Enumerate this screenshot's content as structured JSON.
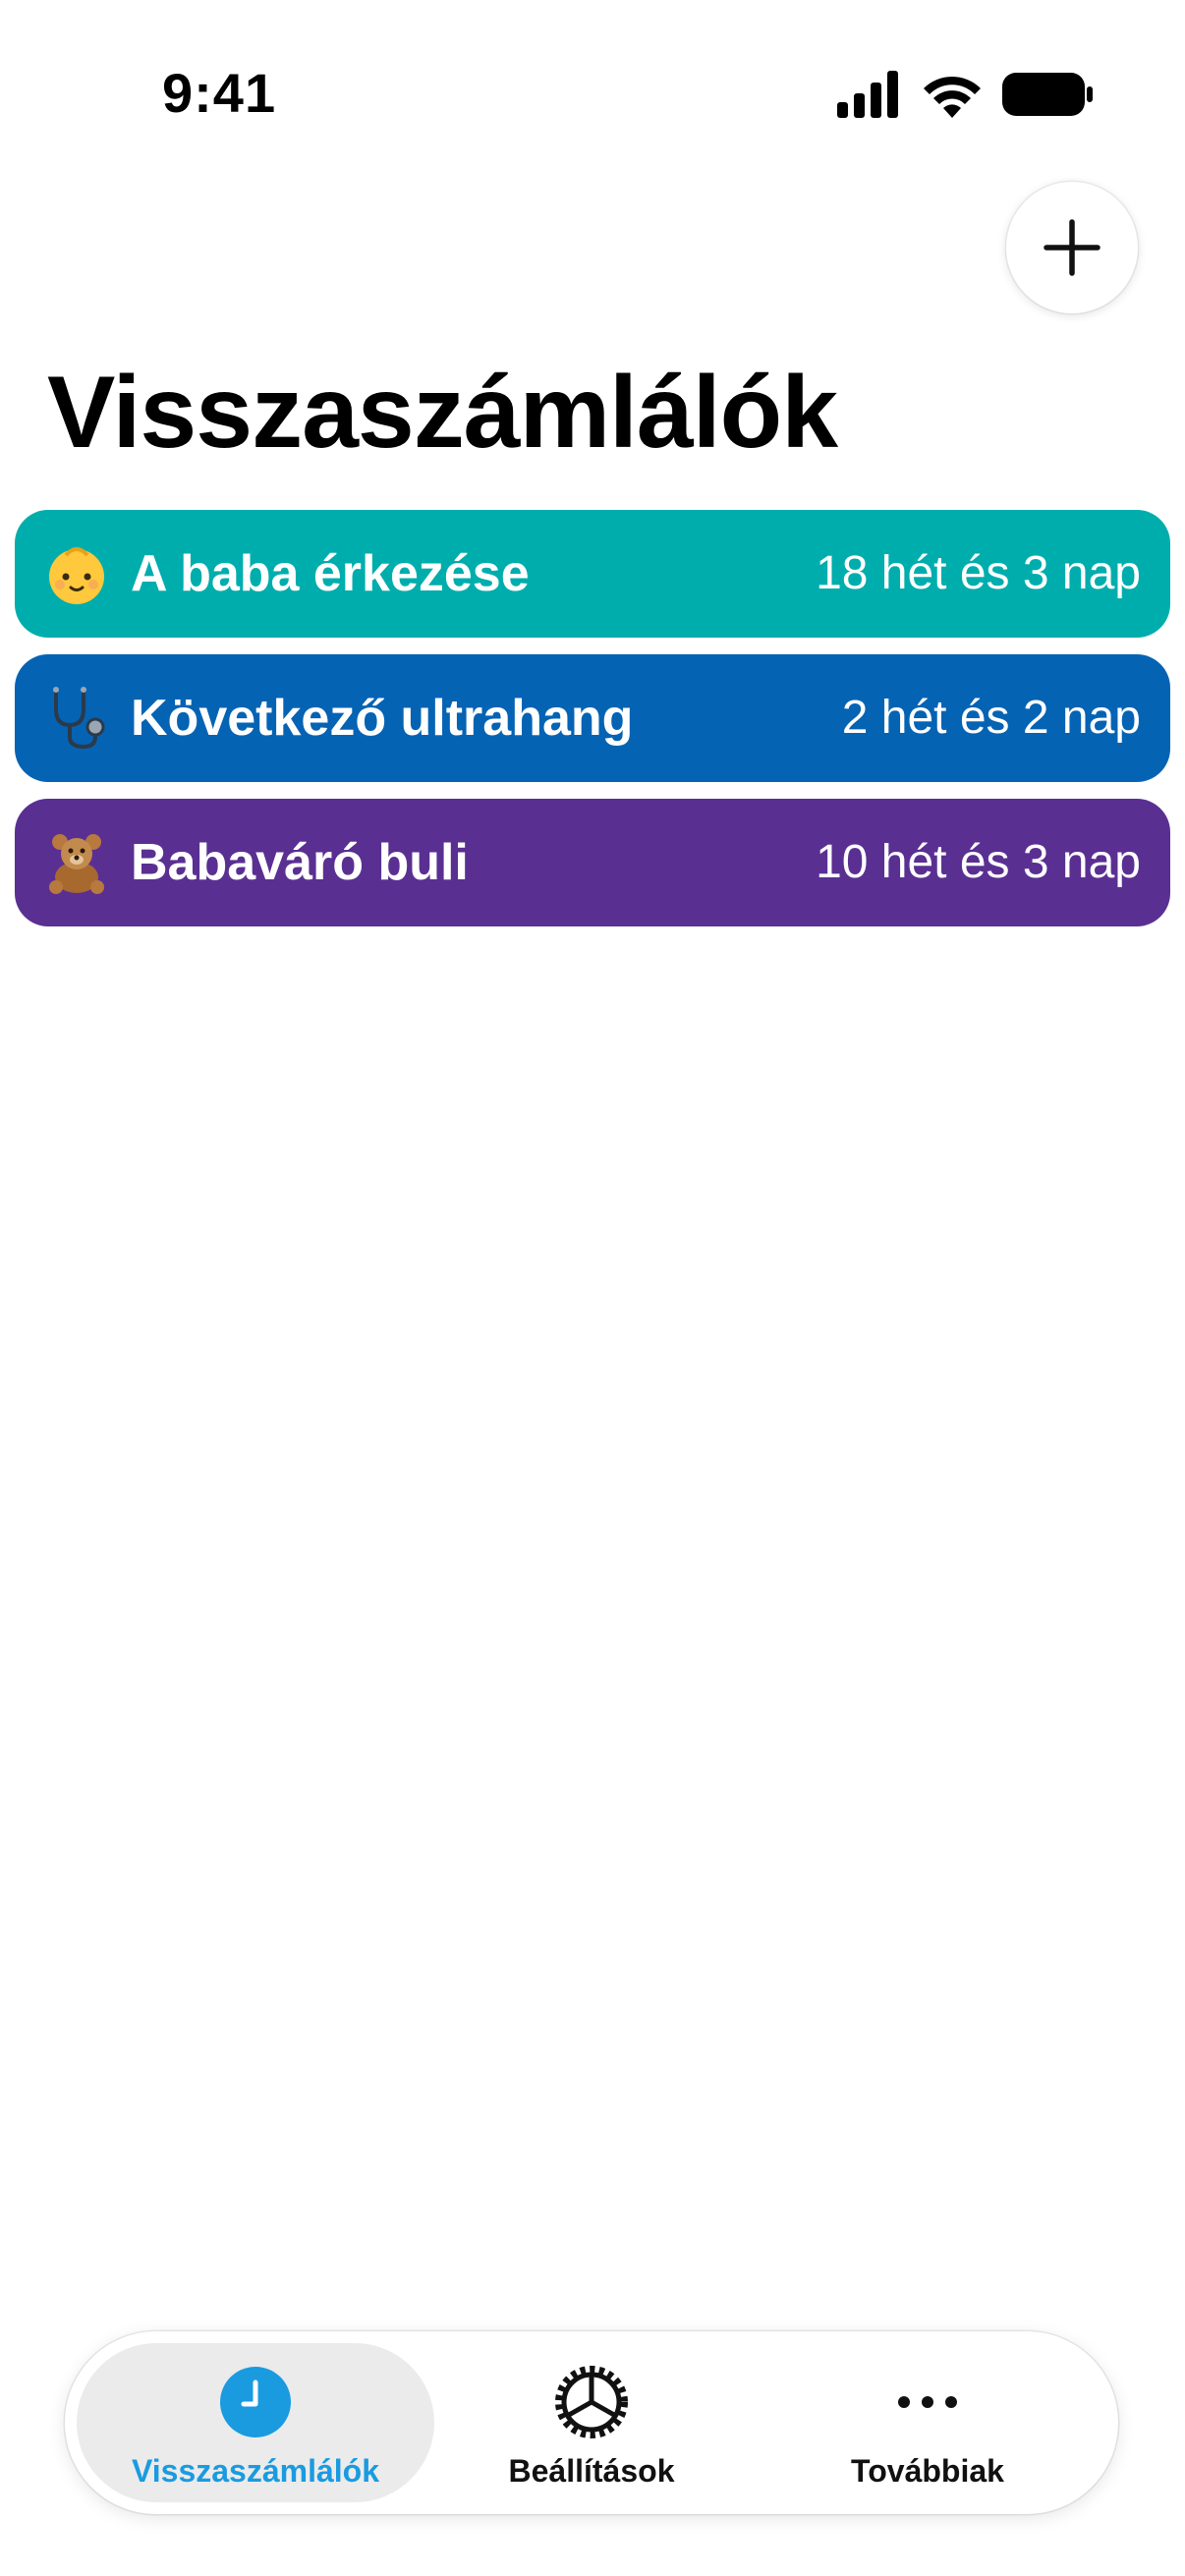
{
  "status_bar": {
    "time": "9:41",
    "icons": [
      "cellular-signal-icon",
      "wifi-icon",
      "battery-icon"
    ]
  },
  "header": {
    "title": "Visszaszámlálók",
    "add_icon": "plus-icon"
  },
  "countdowns": [
    {
      "emoji": "baby-face-icon",
      "name": "A baba érkezése",
      "remaining": "18 hét és 3 nap",
      "color": "#00ADAD"
    },
    {
      "emoji": "stethoscope-icon",
      "name": "Következő ultrahang",
      "remaining": "2 hét és 2 nap",
      "color": "#0563B4"
    },
    {
      "emoji": "teddy-bear-icon",
      "name": "Babaváró buli",
      "remaining": "10 hét és 3 nap",
      "color": "#5A2F92"
    }
  ],
  "tab_bar": {
    "active_color": "#1A9BE0",
    "tabs": [
      {
        "label": "Visszaszámlálók",
        "icon": "clock-icon",
        "active": true
      },
      {
        "label": "Beállítások",
        "icon": "gear-icon",
        "active": false
      },
      {
        "label": "Továbbiak",
        "icon": "ellipsis-icon",
        "active": false
      }
    ]
  }
}
